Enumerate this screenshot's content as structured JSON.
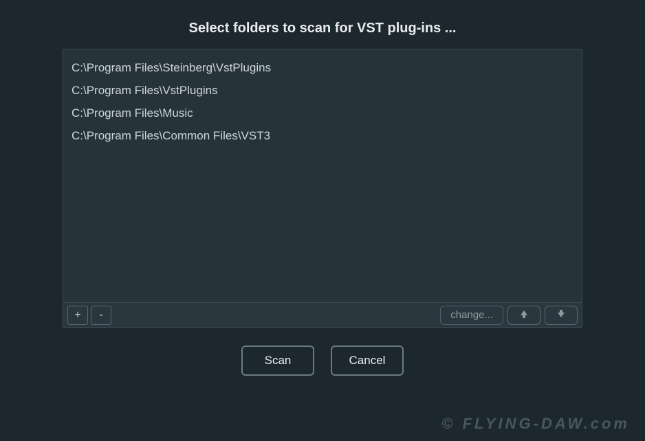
{
  "dialog": {
    "title": "Select folders to scan for VST plug-ins ..."
  },
  "folders": [
    "C:\\Program Files\\Steinberg\\VstPlugins",
    "C:\\Program Files\\VstPlugins",
    "C:\\Program Files\\Music",
    "C:\\Program Files\\Common Files\\VST3"
  ],
  "toolbar": {
    "add_label": "+",
    "remove_label": "-",
    "change_label": "change..."
  },
  "buttons": {
    "scan": "Scan",
    "cancel": "Cancel"
  },
  "watermark": "© FLYING-DAW.com"
}
